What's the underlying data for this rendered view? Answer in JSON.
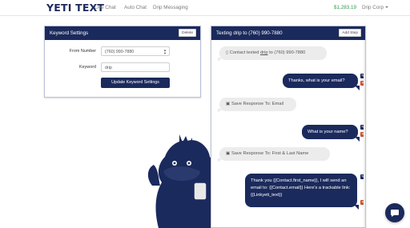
{
  "nav": {
    "logo": "YETI TEXT",
    "links": [
      "Live Chat",
      "Auto Chat",
      "Drip Messaging"
    ],
    "balance": "$1,283.19",
    "account": "Drip Corp"
  },
  "keyword_panel": {
    "title": "Keyword Settings",
    "delete_label": "Delete",
    "from_number_label": "From Number",
    "from_number_value": "(760) 990-7880",
    "keyword_label": "Keyword",
    "keyword_value": "drip",
    "submit_label": "Update Keyword Settings"
  },
  "drip_panel": {
    "title": "Texting drip to (760) 990-7880",
    "add_step_label": "Add Step",
    "messages": [
      {
        "type": "in",
        "prefix": "Contact texted ",
        "keyword": "drip",
        "suffix": " to (760) 990-7880"
      },
      {
        "type": "out",
        "text": "Thanks, what is your email?"
      },
      {
        "type": "in",
        "text": "Save Response To: Email"
      },
      {
        "type": "out",
        "text": "What is your name?"
      },
      {
        "type": "in",
        "text": "Save Response To: First & Last Name"
      },
      {
        "type": "out",
        "text": "Thank you {{Contact.first_name}}, I will send an email to: {{Contact.email}} Here's a trackable link: {{Linkyeti_text}}"
      }
    ]
  },
  "colors": {
    "primary": "#1b2a5c",
    "danger": "#c9502b",
    "balance": "#2e9b4b"
  },
  "icons": [
    "edit-icon",
    "delete-icon",
    "phone-icon",
    "save-icon",
    "chat-icon",
    "yeti-mascot"
  ]
}
